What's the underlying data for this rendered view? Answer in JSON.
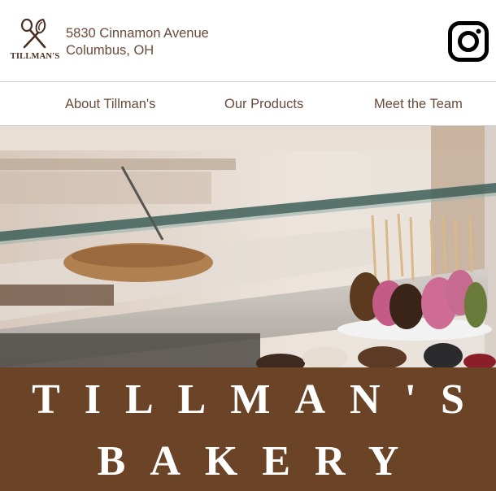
{
  "brand": {
    "logo_text": "TILLMAN'S",
    "icon": "crossed-whisk-spoon-icon"
  },
  "address": {
    "line1": "5830 Cinnamon Avenue",
    "line2": "Columbus, OH"
  },
  "social": {
    "icon": "instagram-icon"
  },
  "nav": {
    "items": [
      {
        "label": "About Tillman's"
      },
      {
        "label": "Our Products"
      },
      {
        "label": "Meet the Team"
      }
    ]
  },
  "banner": {
    "line1": "TILLMAN'S",
    "line2": "BAKERY"
  },
  "colors": {
    "banner_bg": "#6b4427",
    "text_brown": "#6a4a3a"
  }
}
